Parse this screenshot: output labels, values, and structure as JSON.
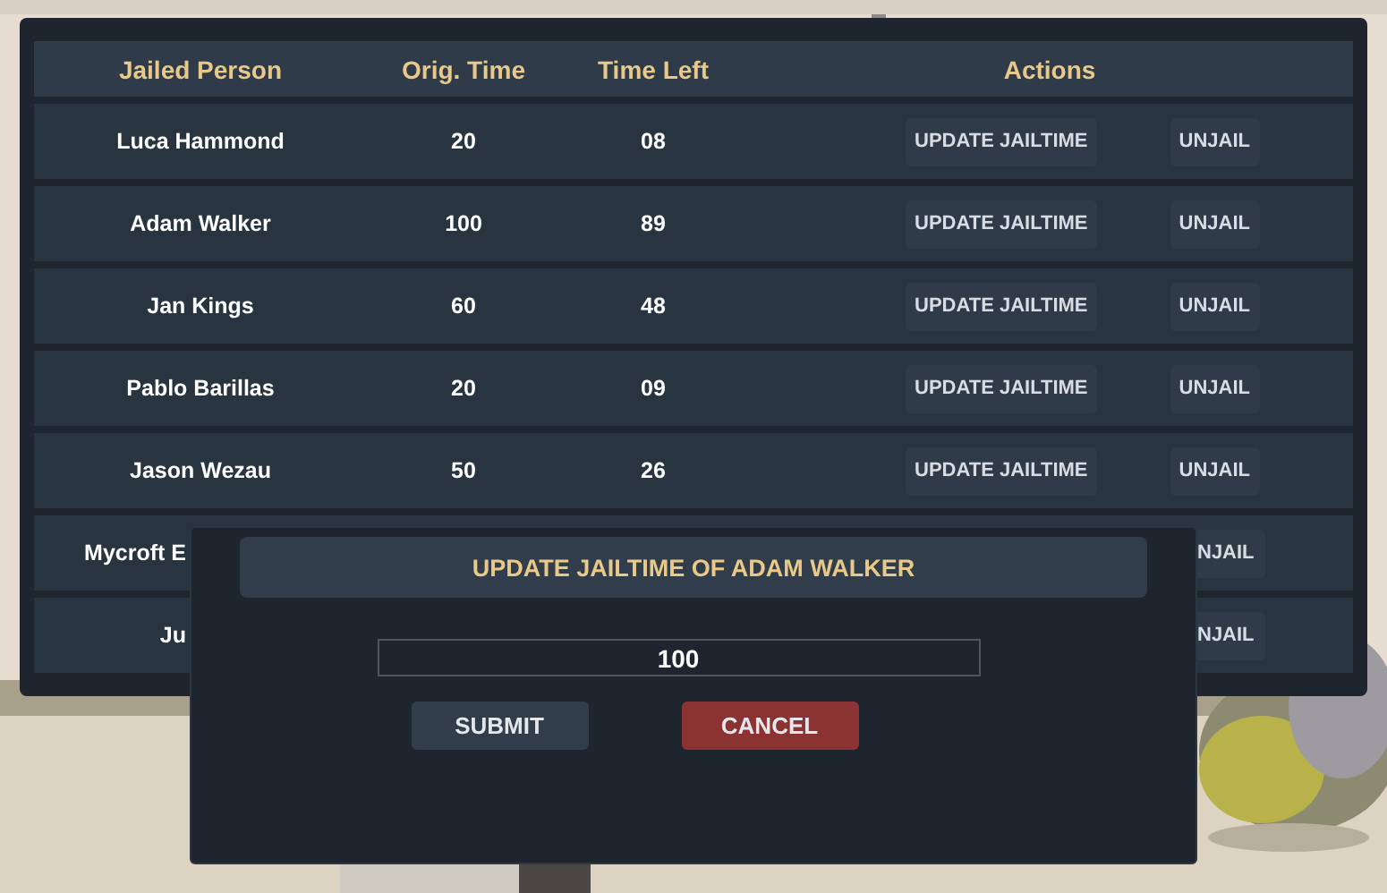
{
  "table": {
    "columns": [
      "Jailed Person",
      "Orig. Time",
      "Time Left",
      "Actions"
    ],
    "rows": [
      {
        "kind": "full",
        "name": "Luca Hammond",
        "orig_time": "20",
        "time_left": "08",
        "buttons": [
          "UPDATE JAILTIME",
          "UNJAIL"
        ]
      },
      {
        "kind": "full",
        "name": "Adam Walker",
        "orig_time": "100",
        "time_left": "89",
        "buttons": [
          "UPDATE JAILTIME",
          "UNJAIL"
        ]
      },
      {
        "kind": "full",
        "name": "Jan Kings",
        "orig_time": "60",
        "time_left": "48",
        "buttons": [
          "UPDATE JAILTIME",
          "UNJAIL"
        ]
      },
      {
        "kind": "full",
        "name": "Pablo Barillas",
        "orig_time": "20",
        "time_left": "09",
        "buttons": [
          "UPDATE JAILTIME",
          "UNJAIL"
        ]
      },
      {
        "kind": "full",
        "name": "Jason Wezau",
        "orig_time": "50",
        "time_left": "26",
        "buttons": [
          "UPDATE JAILTIME",
          "UNJAIL"
        ]
      },
      {
        "kind": "covered",
        "name": "Mycroft E",
        "buttons": [
          "NJAIL"
        ]
      },
      {
        "kind": "covered",
        "name": "Ju",
        "buttons": [
          "NJAIL"
        ]
      }
    ]
  },
  "modal": {
    "title": "UPDATE JAILTIME OF ADAM WALKER",
    "input": {
      "value": "100"
    },
    "buttons": [
      {
        "label": "SUBMIT",
        "kind": "submit"
      },
      {
        "label": "CANCEL",
        "kind": "cancel"
      }
    ]
  }
}
